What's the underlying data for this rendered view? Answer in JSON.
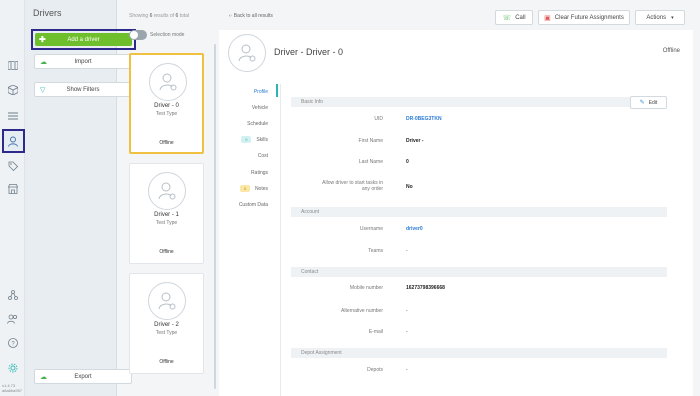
{
  "rail": {
    "icons": [
      "map-icon",
      "package-icon",
      "list-icon",
      "drivers-icon",
      "tags-icon",
      "store-icon",
      "route-network-icon",
      "users-icon",
      "help-icon",
      "settings-icon"
    ],
    "version_line1": "v1.4.73",
    "version_line2": "a8a6ba957"
  },
  "panel": {
    "title": "Drivers",
    "add_label": "Add a driver",
    "import_label": "Import",
    "filters_label": "Show Filters",
    "export_label": "Export"
  },
  "list": {
    "showing_prefix": "Showing ",
    "showing_count": "6",
    "showing_mid": " results of ",
    "showing_total": "6",
    "showing_suffix": " total",
    "selection_mode": "Selection mode",
    "cards": [
      {
        "name": "Driver - 0",
        "type": "Test Type",
        "status": "Offline"
      },
      {
        "name": "Driver - 1",
        "type": "Test Type",
        "status": "Offline"
      },
      {
        "name": "Driver - 2",
        "type": "Test Type",
        "status": "Offline"
      }
    ]
  },
  "topbar": {
    "back": "Back to all results",
    "call": "Call",
    "clear": "Clear Future Assignments",
    "actions": "Actions"
  },
  "driver": {
    "title": "Driver - Driver - 0",
    "status": "Offline"
  },
  "tabs": [
    {
      "label": "Profile",
      "badge": ""
    },
    {
      "label": "Vehicle",
      "badge": ""
    },
    {
      "label": "Schedule",
      "badge": ""
    },
    {
      "label": "Skills",
      "badge": "0"
    },
    {
      "label": "Cost",
      "badge": ""
    },
    {
      "label": "Ratings",
      "badge": ""
    },
    {
      "label": "Notes",
      "badge": "0"
    },
    {
      "label": "Custom Data",
      "badge": ""
    }
  ],
  "profile": {
    "edit": "Edit",
    "basic_info": "Basic Info",
    "uid_label": "UID",
    "uid": "DR-0BEG3TKN",
    "first_name_label": "First Name",
    "first_name": "Driver -",
    "last_name_label": "Last Name",
    "last_name": "0",
    "allow_label": "Allow driver to start tasks in any order",
    "allow": "No",
    "account": "Account",
    "username_label": "Username",
    "username": "driver0",
    "teams_label": "Teams",
    "teams": "-",
    "contact": "Contact",
    "mobile_label": "Mobile number",
    "mobile": "16273798396668",
    "alt_label": "Alternative number",
    "alt": "-",
    "email_label": "E-mail",
    "email": "-",
    "depot": "Depot Assignment",
    "depots_label": "Depots",
    "depots": "-"
  },
  "colors": {
    "add_button": "#6fbf2c",
    "link": "#2a7bd6",
    "highlight_border": "#2e2a8c",
    "selected_card": "#f0c040"
  }
}
